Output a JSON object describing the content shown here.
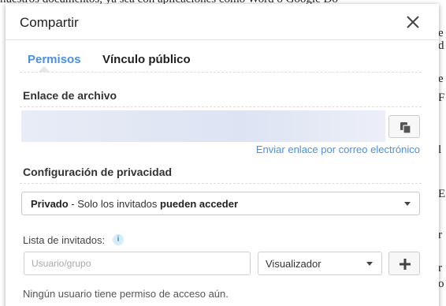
{
  "background": {
    "top_text": "nuestros documentos, ya sea con aplicaciones como Word o Google Do",
    "side_glyphs": [
      "e",
      "d",
      "e",
      "F",
      "l",
      "E",
      "r",
      "r",
      "o"
    ]
  },
  "dialog": {
    "title": "Compartir",
    "close_icon": "close-icon",
    "tabs": [
      {
        "label": "Permisos",
        "active": true
      },
      {
        "label": "Vínculo público",
        "active": false
      }
    ],
    "file_link": {
      "label": "Enlace de archivo",
      "value": "",
      "copy_icon": "copy-icon",
      "email_link": "Enviar enlace por correo electrónico"
    },
    "privacy": {
      "label": "Configuración de privacidad",
      "selected_bold": "Privado",
      "selected_mid": " - Solo los invitados ",
      "selected_end_bold": "pueden acceder"
    },
    "invites": {
      "label": "Lista de invitados:",
      "info_icon": "info-icon",
      "user_placeholder": "Usuario/grupo",
      "role_selected": "Visualizador",
      "add_icon": "plus-icon",
      "empty_text": "Ningún usuario tiene permiso de acceso aún."
    }
  },
  "colors": {
    "accent": "#4a90e2",
    "link_box": "#dde3f3"
  }
}
